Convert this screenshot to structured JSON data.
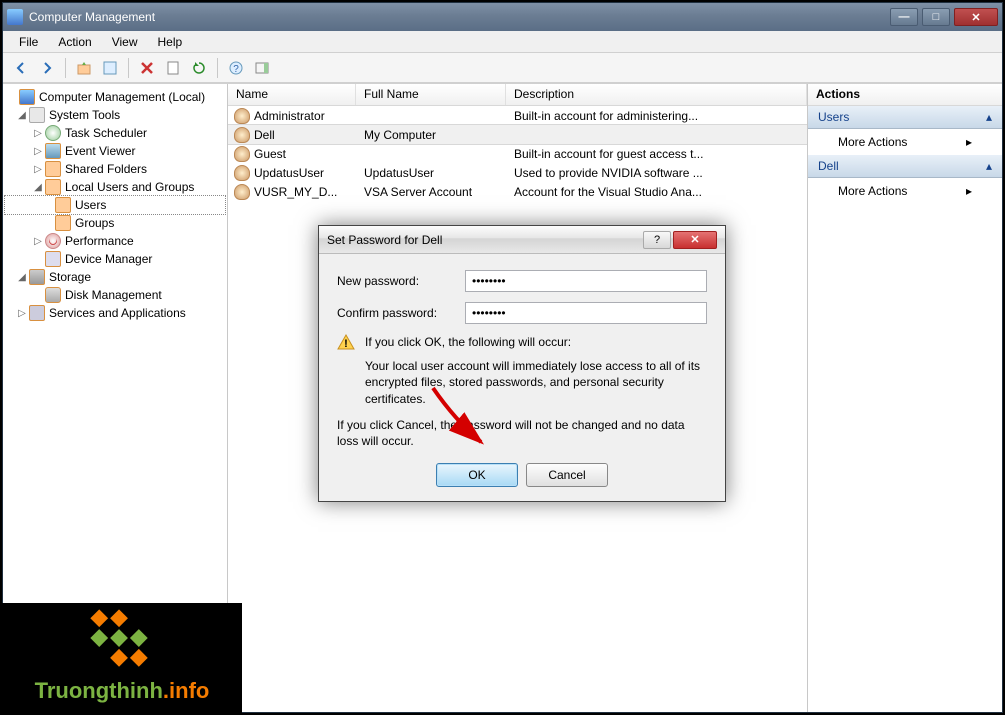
{
  "window": {
    "title": "Computer Management"
  },
  "menu": {
    "file": "File",
    "action": "Action",
    "view": "View",
    "help": "Help"
  },
  "tree": {
    "root": "Computer Management (Local)",
    "system_tools": "System Tools",
    "task_scheduler": "Task Scheduler",
    "event_viewer": "Event Viewer",
    "shared_folders": "Shared Folders",
    "local_users": "Local Users and Groups",
    "users": "Users",
    "groups": "Groups",
    "performance": "Performance",
    "device_manager": "Device Manager",
    "storage": "Storage",
    "disk_management": "Disk Management",
    "services": "Services and Applications"
  },
  "list": {
    "headers": {
      "name": "Name",
      "full": "Full Name",
      "desc": "Description"
    },
    "rows": [
      {
        "name": "Administrator",
        "full": "",
        "desc": "Built-in account for administering..."
      },
      {
        "name": "Dell",
        "full": "My Computer",
        "desc": ""
      },
      {
        "name": "Guest",
        "full": "",
        "desc": "Built-in account for guest access t..."
      },
      {
        "name": "UpdatusUser",
        "full": "UpdatusUser",
        "desc": "Used to provide NVIDIA software ..."
      },
      {
        "name": "VUSR_MY_D...",
        "full": "VSA Server Account",
        "desc": "Account for the Visual Studio Ana..."
      }
    ]
  },
  "actions": {
    "title": "Actions",
    "section1": "Users",
    "more1": "More Actions",
    "section2": "Dell",
    "more2": "More Actions"
  },
  "dialog": {
    "title": "Set Password for Dell",
    "new_pw": "New password:",
    "confirm_pw": "Confirm password:",
    "warn1": "If you click OK, the following will occur:",
    "warn2": "Your local user account will immediately lose access to all of its encrypted files, stored passwords, and personal security certificates.",
    "warn3": "If you click Cancel, the password will not be changed and no data loss will occur.",
    "ok": "OK",
    "cancel": "Cancel",
    "pw_value": "••••••••"
  },
  "watermark": {
    "text_pre": "Truongthinh",
    "text_suf": ".info"
  }
}
